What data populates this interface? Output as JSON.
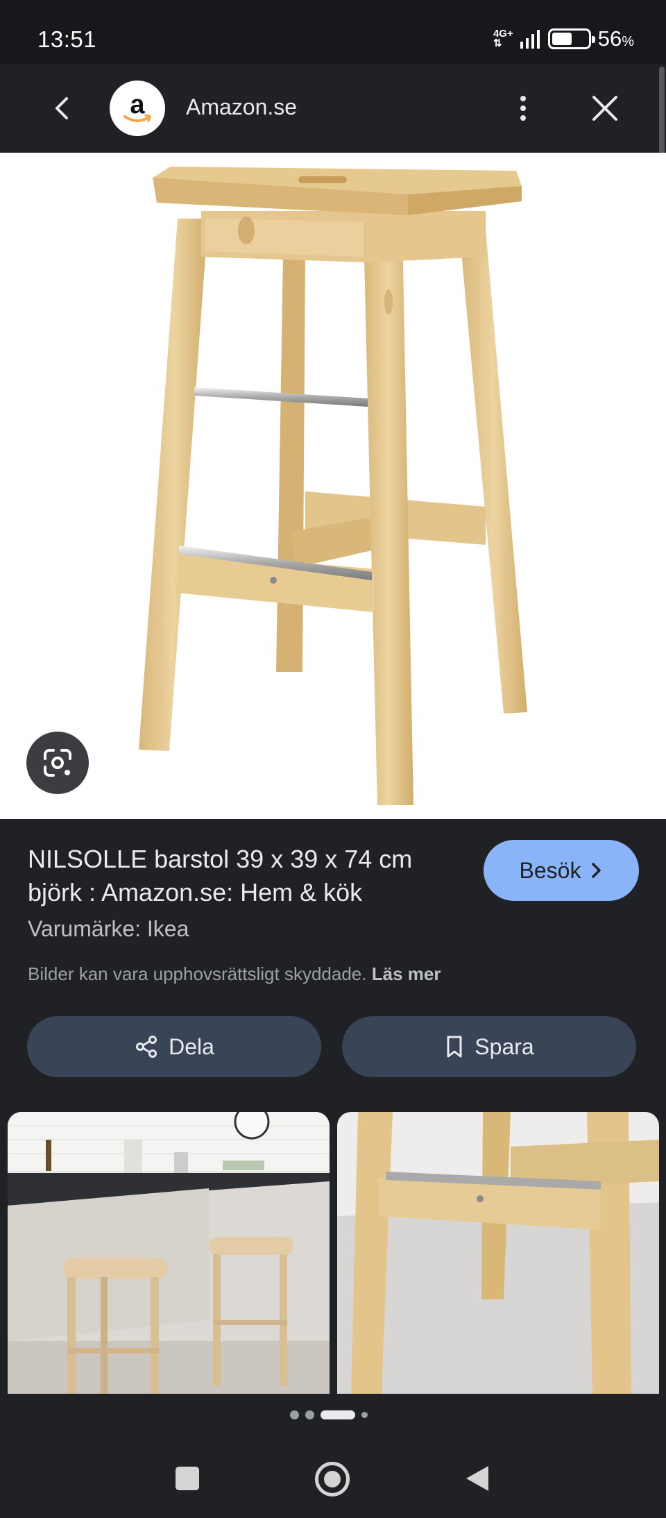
{
  "status_bar": {
    "time": "13:51",
    "network": "4G+",
    "battery_percent": "56",
    "battery_symbol": "%",
    "battery_level": 0.56
  },
  "app_bar": {
    "site_name": "Amazon.se",
    "favicon_letter": "a",
    "icons": [
      "back-arrow-icon",
      "more-vert-icon",
      "close-icon"
    ]
  },
  "product": {
    "title": "NILSOLLE barstol 39 x 39 x 74 cm björk : Amazon.se: Hem & kök",
    "brand": "Varumärke: Ikea",
    "copyright_notice": "Bilder kan vara upphovsrättsligt skyddade.",
    "read_more": "Läs mer"
  },
  "buttons": {
    "visit": "Besök",
    "share": "Dela",
    "save": "Spara"
  },
  "carousel": {
    "page_count": 4,
    "active_index": 2
  },
  "colors": {
    "background": "#202124",
    "accent": "#8ab4f8",
    "chip": "#394457",
    "wood": "#e0c287"
  }
}
